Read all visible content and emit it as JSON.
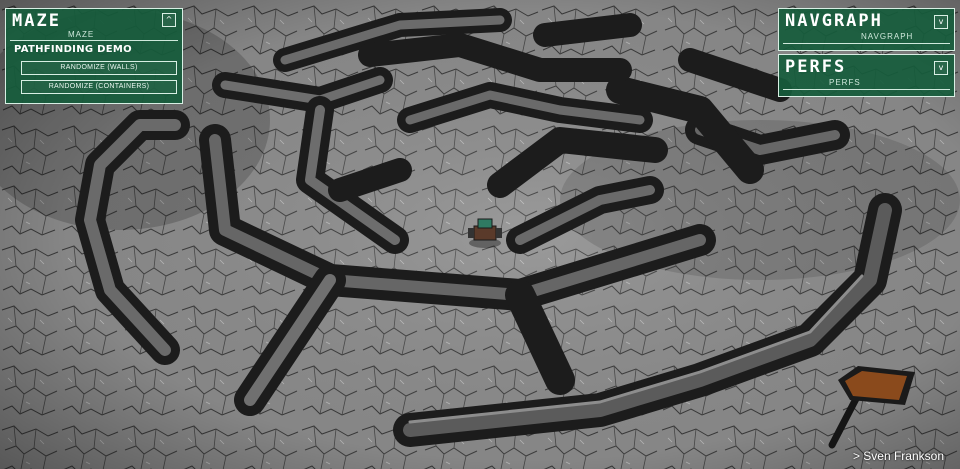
{
  "maze_panel": {
    "title": "MAZE",
    "subtitle": "MAZE",
    "toggle": "^",
    "heading": "PATHFINDING DEMO",
    "buttons": [
      "RANDOMIZE (WALLS)",
      "RANDOMIZE (CONTAINERS)"
    ]
  },
  "navgraph_panel": {
    "title": "NAVGRAPH",
    "subtitle": "NAVGRAPH",
    "toggle": "v"
  },
  "perfs_panel": {
    "title": "PERFS",
    "subtitle": "PERFS",
    "toggle": "v"
  },
  "credit": "> Sven Frankson",
  "colors": {
    "panel_bg": "#165c3c",
    "panel_border": "#d8efe4",
    "ground": "#8a8a8a",
    "wall": "#2b2b2b",
    "sign_board": "#8a4a1c"
  }
}
